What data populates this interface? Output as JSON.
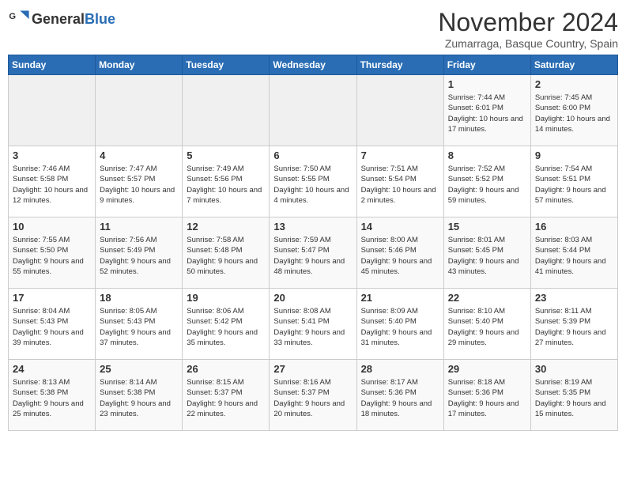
{
  "header": {
    "logo_general": "General",
    "logo_blue": "Blue",
    "month_title": "November 2024",
    "location": "Zumarraga, Basque Country, Spain"
  },
  "weekdays": [
    "Sunday",
    "Monday",
    "Tuesday",
    "Wednesday",
    "Thursday",
    "Friday",
    "Saturday"
  ],
  "weeks": [
    [
      {
        "day": "",
        "info": ""
      },
      {
        "day": "",
        "info": ""
      },
      {
        "day": "",
        "info": ""
      },
      {
        "day": "",
        "info": ""
      },
      {
        "day": "",
        "info": ""
      },
      {
        "day": "1",
        "info": "Sunrise: 7:44 AM\nSunset: 6:01 PM\nDaylight: 10 hours and 17 minutes."
      },
      {
        "day": "2",
        "info": "Sunrise: 7:45 AM\nSunset: 6:00 PM\nDaylight: 10 hours and 14 minutes."
      }
    ],
    [
      {
        "day": "3",
        "info": "Sunrise: 7:46 AM\nSunset: 5:58 PM\nDaylight: 10 hours and 12 minutes."
      },
      {
        "day": "4",
        "info": "Sunrise: 7:47 AM\nSunset: 5:57 PM\nDaylight: 10 hours and 9 minutes."
      },
      {
        "day": "5",
        "info": "Sunrise: 7:49 AM\nSunset: 5:56 PM\nDaylight: 10 hours and 7 minutes."
      },
      {
        "day": "6",
        "info": "Sunrise: 7:50 AM\nSunset: 5:55 PM\nDaylight: 10 hours and 4 minutes."
      },
      {
        "day": "7",
        "info": "Sunrise: 7:51 AM\nSunset: 5:54 PM\nDaylight: 10 hours and 2 minutes."
      },
      {
        "day": "8",
        "info": "Sunrise: 7:52 AM\nSunset: 5:52 PM\nDaylight: 9 hours and 59 minutes."
      },
      {
        "day": "9",
        "info": "Sunrise: 7:54 AM\nSunset: 5:51 PM\nDaylight: 9 hours and 57 minutes."
      }
    ],
    [
      {
        "day": "10",
        "info": "Sunrise: 7:55 AM\nSunset: 5:50 PM\nDaylight: 9 hours and 55 minutes."
      },
      {
        "day": "11",
        "info": "Sunrise: 7:56 AM\nSunset: 5:49 PM\nDaylight: 9 hours and 52 minutes."
      },
      {
        "day": "12",
        "info": "Sunrise: 7:58 AM\nSunset: 5:48 PM\nDaylight: 9 hours and 50 minutes."
      },
      {
        "day": "13",
        "info": "Sunrise: 7:59 AM\nSunset: 5:47 PM\nDaylight: 9 hours and 48 minutes."
      },
      {
        "day": "14",
        "info": "Sunrise: 8:00 AM\nSunset: 5:46 PM\nDaylight: 9 hours and 45 minutes."
      },
      {
        "day": "15",
        "info": "Sunrise: 8:01 AM\nSunset: 5:45 PM\nDaylight: 9 hours and 43 minutes."
      },
      {
        "day": "16",
        "info": "Sunrise: 8:03 AM\nSunset: 5:44 PM\nDaylight: 9 hours and 41 minutes."
      }
    ],
    [
      {
        "day": "17",
        "info": "Sunrise: 8:04 AM\nSunset: 5:43 PM\nDaylight: 9 hours and 39 minutes."
      },
      {
        "day": "18",
        "info": "Sunrise: 8:05 AM\nSunset: 5:43 PM\nDaylight: 9 hours and 37 minutes."
      },
      {
        "day": "19",
        "info": "Sunrise: 8:06 AM\nSunset: 5:42 PM\nDaylight: 9 hours and 35 minutes."
      },
      {
        "day": "20",
        "info": "Sunrise: 8:08 AM\nSunset: 5:41 PM\nDaylight: 9 hours and 33 minutes."
      },
      {
        "day": "21",
        "info": "Sunrise: 8:09 AM\nSunset: 5:40 PM\nDaylight: 9 hours and 31 minutes."
      },
      {
        "day": "22",
        "info": "Sunrise: 8:10 AM\nSunset: 5:40 PM\nDaylight: 9 hours and 29 minutes."
      },
      {
        "day": "23",
        "info": "Sunrise: 8:11 AM\nSunset: 5:39 PM\nDaylight: 9 hours and 27 minutes."
      }
    ],
    [
      {
        "day": "24",
        "info": "Sunrise: 8:13 AM\nSunset: 5:38 PM\nDaylight: 9 hours and 25 minutes."
      },
      {
        "day": "25",
        "info": "Sunrise: 8:14 AM\nSunset: 5:38 PM\nDaylight: 9 hours and 23 minutes."
      },
      {
        "day": "26",
        "info": "Sunrise: 8:15 AM\nSunset: 5:37 PM\nDaylight: 9 hours and 22 minutes."
      },
      {
        "day": "27",
        "info": "Sunrise: 8:16 AM\nSunset: 5:37 PM\nDaylight: 9 hours and 20 minutes."
      },
      {
        "day": "28",
        "info": "Sunrise: 8:17 AM\nSunset: 5:36 PM\nDaylight: 9 hours and 18 minutes."
      },
      {
        "day": "29",
        "info": "Sunrise: 8:18 AM\nSunset: 5:36 PM\nDaylight: 9 hours and 17 minutes."
      },
      {
        "day": "30",
        "info": "Sunrise: 8:19 AM\nSunset: 5:35 PM\nDaylight: 9 hours and 15 minutes."
      }
    ]
  ]
}
